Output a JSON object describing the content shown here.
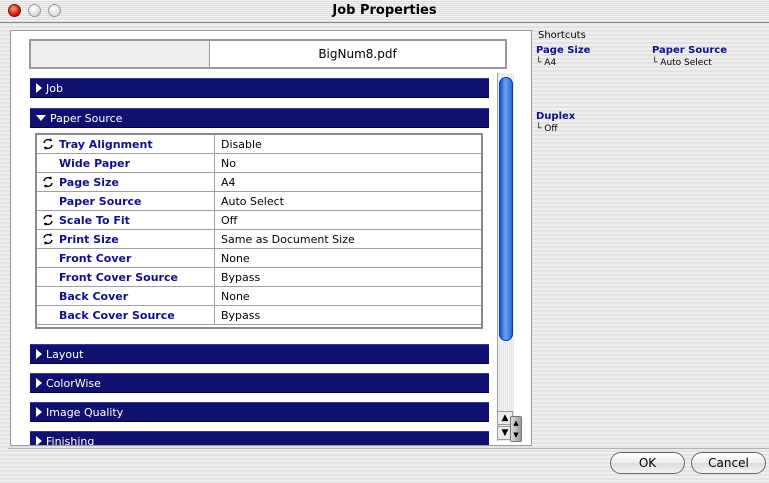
{
  "window": {
    "title": "Job Properties"
  },
  "header": {
    "filename": "BigNum8.pdf"
  },
  "sections": {
    "job": "Job",
    "paper_source": "Paper Source",
    "layout": "Layout",
    "colorwise": "ColorWise",
    "image_quality": "Image Quality",
    "finishing": "Finishing"
  },
  "paper_source_rows": [
    {
      "label": "Tray Alignment",
      "value": "Disable",
      "sync": true
    },
    {
      "label": "Wide Paper",
      "value": "No",
      "sync": false
    },
    {
      "label": "Page Size",
      "value": "A4",
      "sync": true
    },
    {
      "label": "Paper Source",
      "value": "Auto Select",
      "sync": false
    },
    {
      "label": "Scale To Fit",
      "value": "Off",
      "sync": true
    },
    {
      "label": "Print Size",
      "value": "Same as Document Size",
      "sync": true
    },
    {
      "label": "Front Cover",
      "value": "None",
      "sync": false
    },
    {
      "label": "Front Cover Source",
      "value": "Bypass",
      "sync": false
    },
    {
      "label": "Back Cover",
      "value": "None",
      "sync": false
    },
    {
      "label": "Back Cover Source",
      "value": "Bypass",
      "sync": false
    }
  ],
  "shortcuts": {
    "title": "Shortcuts",
    "page_size": {
      "label": "Page Size",
      "value": "A4"
    },
    "paper_source": {
      "label": "Paper Source",
      "value": "Auto Select"
    },
    "duplex": {
      "label": "Duplex",
      "value": "Off"
    }
  },
  "buttons": {
    "ok": "OK",
    "cancel": "Cancel"
  },
  "colors": {
    "section_bar": "#10106e",
    "label_text": "#10108a",
    "scroll_thumb": "#2a66d8"
  },
  "icons": {
    "sync": "sync-arrows-icon"
  }
}
